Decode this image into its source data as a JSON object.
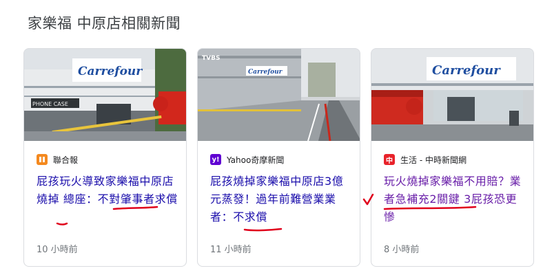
{
  "section": {
    "title": "家樂福 中原店相關新聞"
  },
  "cards": [
    {
      "source": "聯合報",
      "icon_color": "#f4891f",
      "headline": "屁孩玩火導致家樂福中原店燒掉 總座：不對肇事者求償",
      "time": "10 小時前",
      "thumb_sign": "Carrefour",
      "thumb_shop": "PHONE CASE"
    },
    {
      "source": "Yahoo奇摩新聞",
      "icon_color": "#6001d2",
      "icon_glyph": "y!",
      "headline": "屁孩燒掉家樂福中原店3億元蒸發！過年前難營業業者：不求償",
      "time": "11 小時前",
      "thumb_watermark": "TVBS"
    },
    {
      "source": "生活 - 中時新聞網",
      "icon_color": "#e8222a",
      "icon_glyph": "中",
      "headline": "玩火燒掉家樂福不用賠？業者急補充2關鍵 3屁孩恐更慘",
      "time": "8 小時前",
      "thumb_sign": "Carrefour"
    }
  ],
  "colors": {
    "link": "#1a0dab",
    "visited": "#681da8",
    "annotation": "#e0001b"
  }
}
